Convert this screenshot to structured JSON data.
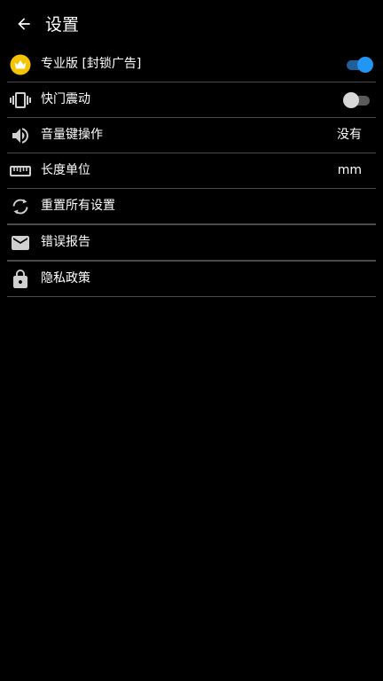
{
  "app_bar": {
    "title": "设置",
    "back_icon": "arrow-left-icon"
  },
  "accent_color": "#2196f3",
  "settings": {
    "items": [
      {
        "label": "专业版 [封锁广告]",
        "icon": "crown-icon",
        "control": "toggle",
        "on": true
      },
      {
        "label": "快门震动",
        "icon": "vibration-icon",
        "control": "toggle",
        "on": false
      },
      {
        "label": "音量键操作",
        "icon": "volume-icon",
        "control": "value",
        "value": "没有"
      },
      {
        "label": "长度单位",
        "icon": "ruler-icon",
        "control": "value",
        "value": "mm"
      },
      {
        "label": "重置所有设置",
        "icon": "reset-icon",
        "control": "none"
      },
      {
        "label": "错误报告",
        "icon": "mail-icon",
        "control": "none"
      },
      {
        "label": "隐私政策",
        "icon": "lock-icon",
        "control": "none"
      }
    ]
  }
}
